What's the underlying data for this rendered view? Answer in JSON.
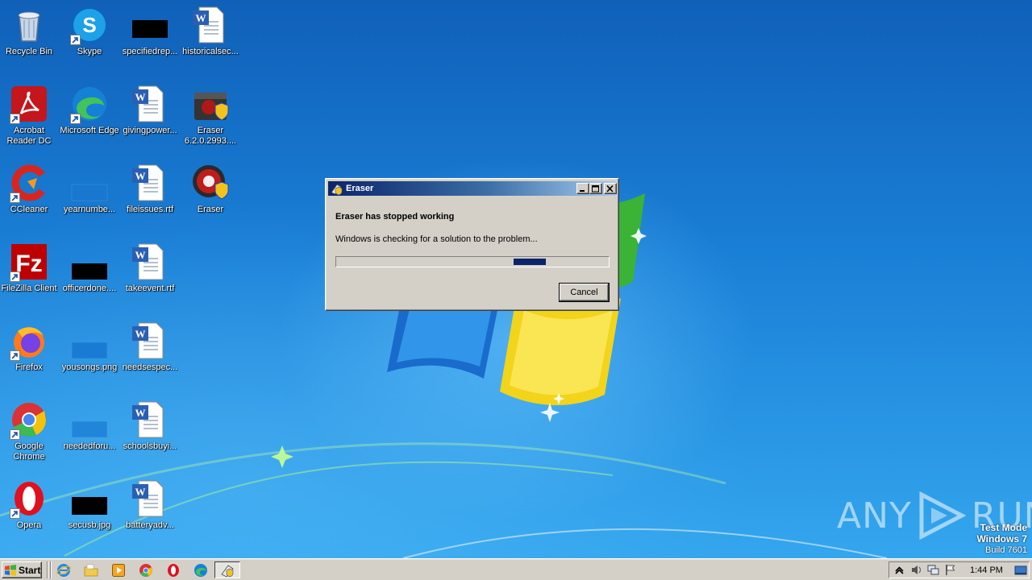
{
  "desktop": {
    "icons": [
      {
        "label": "Recycle Bin",
        "icon": "recycle-bin-icon"
      },
      {
        "label": "Skype",
        "icon": "skype-icon"
      },
      {
        "label": "specifiedrep...",
        "icon": "black-image-icon"
      },
      {
        "label": "historicalsec...",
        "icon": "word-document-icon"
      },
      {
        "label": "Acrobat Reader DC",
        "icon": "acrobat-icon"
      },
      {
        "label": "Microsoft Edge",
        "icon": "edge-icon"
      },
      {
        "label": "givingpower...",
        "icon": "word-document-icon"
      },
      {
        "label": "Eraser 6.2.0.2993....",
        "icon": "eraser-installer-icon"
      },
      {
        "label": "CCleaner",
        "icon": "ccleaner-icon"
      },
      {
        "label": "yearnumbe...",
        "icon": "blue-image-icon"
      },
      {
        "label": "fileissues.rtf",
        "icon": "word-document-icon"
      },
      {
        "label": "Eraser",
        "icon": "eraser-icon"
      },
      {
        "label": "FileZilla Client",
        "icon": "filezilla-icon"
      },
      {
        "label": "officerdone....",
        "icon": "black-image-icon"
      },
      {
        "label": "takeevent.rtf",
        "icon": "word-document-icon"
      },
      {
        "label": "Firefox",
        "icon": "firefox-icon"
      },
      {
        "label": "yousongs.png",
        "icon": "blue-image-icon"
      },
      {
        "label": "needsespec...",
        "icon": "word-document-icon"
      },
      {
        "label": "Google Chrome",
        "icon": "chrome-icon"
      },
      {
        "label": "neededforu...",
        "icon": "blue-image-icon"
      },
      {
        "label": "schoolsbuyi...",
        "icon": "word-document-icon"
      },
      {
        "label": "Opera",
        "icon": "opera-icon"
      },
      {
        "label": "secusb.jpg",
        "icon": "black-image-icon"
      },
      {
        "label": "batteryadv...",
        "icon": "word-document-icon"
      }
    ]
  },
  "dialog": {
    "title": "Eraser",
    "heading": "Eraser has stopped working",
    "message": "Windows is checking for a solution to the problem...",
    "progress": {
      "indeterminate": true,
      "marquee_position": 0.65
    },
    "cancel_label": "Cancel"
  },
  "watermark": {
    "brand_left": "ANY",
    "brand_right": "RUN",
    "test_mode": "Test Mode",
    "os": "Windows 7",
    "build": "Build 7601"
  },
  "taskbar": {
    "start_label": "Start",
    "quick_launch": [
      "ie-icon",
      "explorer-icon",
      "media-player-icon",
      "chrome-icon",
      "opera-icon",
      "edge-icon"
    ],
    "tasks": [
      {
        "name": "Eraser",
        "icon": "eraser-icon",
        "active": true
      }
    ],
    "clock": "1:44 PM"
  },
  "colors": {
    "dialog_face": "#d4d0c8",
    "titlebar_start": "#0a246a",
    "titlebar_end": "#a6caf0",
    "progress_fill": "#0a246a",
    "desktop_blue": "#1a7fd6"
  }
}
